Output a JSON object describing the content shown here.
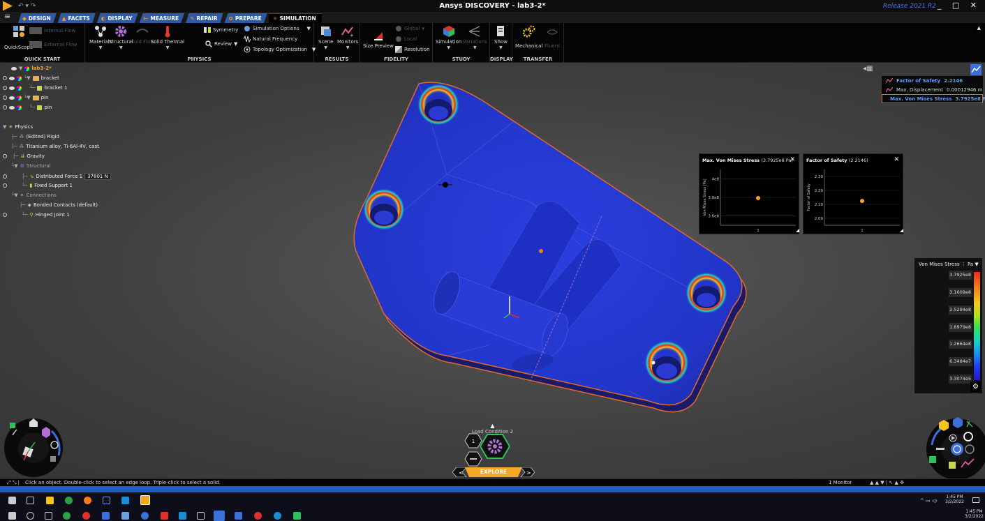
{
  "window": {
    "title": "Ansys DISCOVERY - lab3-2*",
    "release": "Release 2021 R2",
    "controls": "_ □ ✕"
  },
  "tabs": [
    {
      "label": "Design"
    },
    {
      "label": "Facets"
    },
    {
      "label": "Display"
    },
    {
      "label": "Measure"
    },
    {
      "label": "Repair"
    },
    {
      "label": "Prepare"
    },
    {
      "label": "Simulation"
    }
  ],
  "ribbon": {
    "quick_start": {
      "label": "Quick Start",
      "quickscope": "QuickScope",
      "internal_flow": "Internal Flow",
      "external_flow": "External Flow"
    },
    "physics": {
      "label": "Physics",
      "materials": "Materials",
      "structural": "Structural",
      "fluid_flow": "Fluid Flow",
      "solid_thermal": "Solid Thermal",
      "symmetry": "Symmetry",
      "review": "Review",
      "simulation_options": "Simulation Options",
      "natural_frequency": "Natural Frequency",
      "topology_optimization": "Topology Optimization"
    },
    "results": {
      "label": "Results",
      "scene": "Scene",
      "monitors": "Monitors"
    },
    "fidelity": {
      "label": "Fidelity",
      "size_preview": "Size Preview",
      "global": "Global",
      "local": "Local",
      "resolution": "Resolution"
    },
    "study": {
      "label": "Study",
      "simulation": "Simulation",
      "variations": "Variations"
    },
    "display": {
      "label": "Display",
      "show": "Show"
    },
    "transfer": {
      "label": "Transfer",
      "mechanical": "Mechanical",
      "fluent": "Fluent"
    }
  },
  "tree": {
    "root": "lab3-2*",
    "bracket_folder": "bracket",
    "bracket_body": "bracket 1",
    "pin_folder": "pin",
    "pin_body": "pin",
    "physics": "Physics",
    "edited_rigid": "(Edited) Rigid",
    "material": "Titanium alloy, Ti-6Al-4V, cast",
    "gravity": "Gravity",
    "structural": "Structural",
    "distributed_force": "Distributed Force 1",
    "force_value": "37801 N",
    "fixed_support": "Fixed Support 1",
    "connections": "Connections",
    "bonded_contacts": "Bonded Contacts (default)",
    "hinged_joint": "Hinged Joint 1"
  },
  "stats": [
    {
      "label": "Factor of Safety",
      "value": "2.2146",
      "style": "hl"
    },
    {
      "label": "Max. Displacement",
      "value": "0.00012946 m",
      "style": "plain"
    },
    {
      "label": "Max. Von Mises Stress",
      "value": "3.7925e8 Pa",
      "style": "sel"
    }
  ],
  "monitors": [
    {
      "title": "Max. Von Mises Stress",
      "value": "(3.7925e8 Pa)",
      "ylabel": "Von Mises Stress [Pa]",
      "yticks": [
        "4e8",
        "3.8e8",
        "3.6e8"
      ],
      "xtick": "1"
    },
    {
      "title": "Factor of Safety",
      "value": "(2.2146)",
      "ylabel": "Factor of Safety",
      "yticks": [
        "2.39",
        "2.29",
        "2.19",
        "2.09"
      ],
      "xtick": "1"
    }
  ],
  "chart_data": [
    {
      "type": "scatter",
      "title": "Max. Von Mises Stress (3.7925e8 Pa)",
      "ylabel": "Von Mises Stress [Pa]",
      "x": [
        1
      ],
      "y": [
        379250000
      ],
      "yticks": [
        360000000,
        380000000,
        400000000
      ],
      "ylim": [
        350000000,
        410000000
      ]
    },
    {
      "type": "scatter",
      "title": "Factor of Safety (2.2146)",
      "ylabel": "Factor of Safety",
      "x": [
        1
      ],
      "y": [
        2.2146
      ],
      "yticks": [
        2.09,
        2.19,
        2.29,
        2.39
      ],
      "ylim": [
        2.04,
        2.44
      ]
    }
  ],
  "legend": {
    "title": "Von Mises Stress",
    "unit": "Pa",
    "ticks": [
      "3.7925e8",
      "3.1609e8",
      "2.5294e8",
      "1.8979e8",
      "1.2664e8",
      "6.3484e7",
      "3.3074e5"
    ]
  },
  "load_condition": "Load Condition 2",
  "explore": "Explore",
  "status": {
    "hint": "Click an object. Double-click to select an edge loop. Triple-click to select a solid.",
    "monitor": "1 Monitor"
  },
  "taskbar": {
    "time1": "1:45 PM",
    "date1": "3/2/2022",
    "time2": "1:45 PM",
    "date2": "3/2/2022"
  }
}
